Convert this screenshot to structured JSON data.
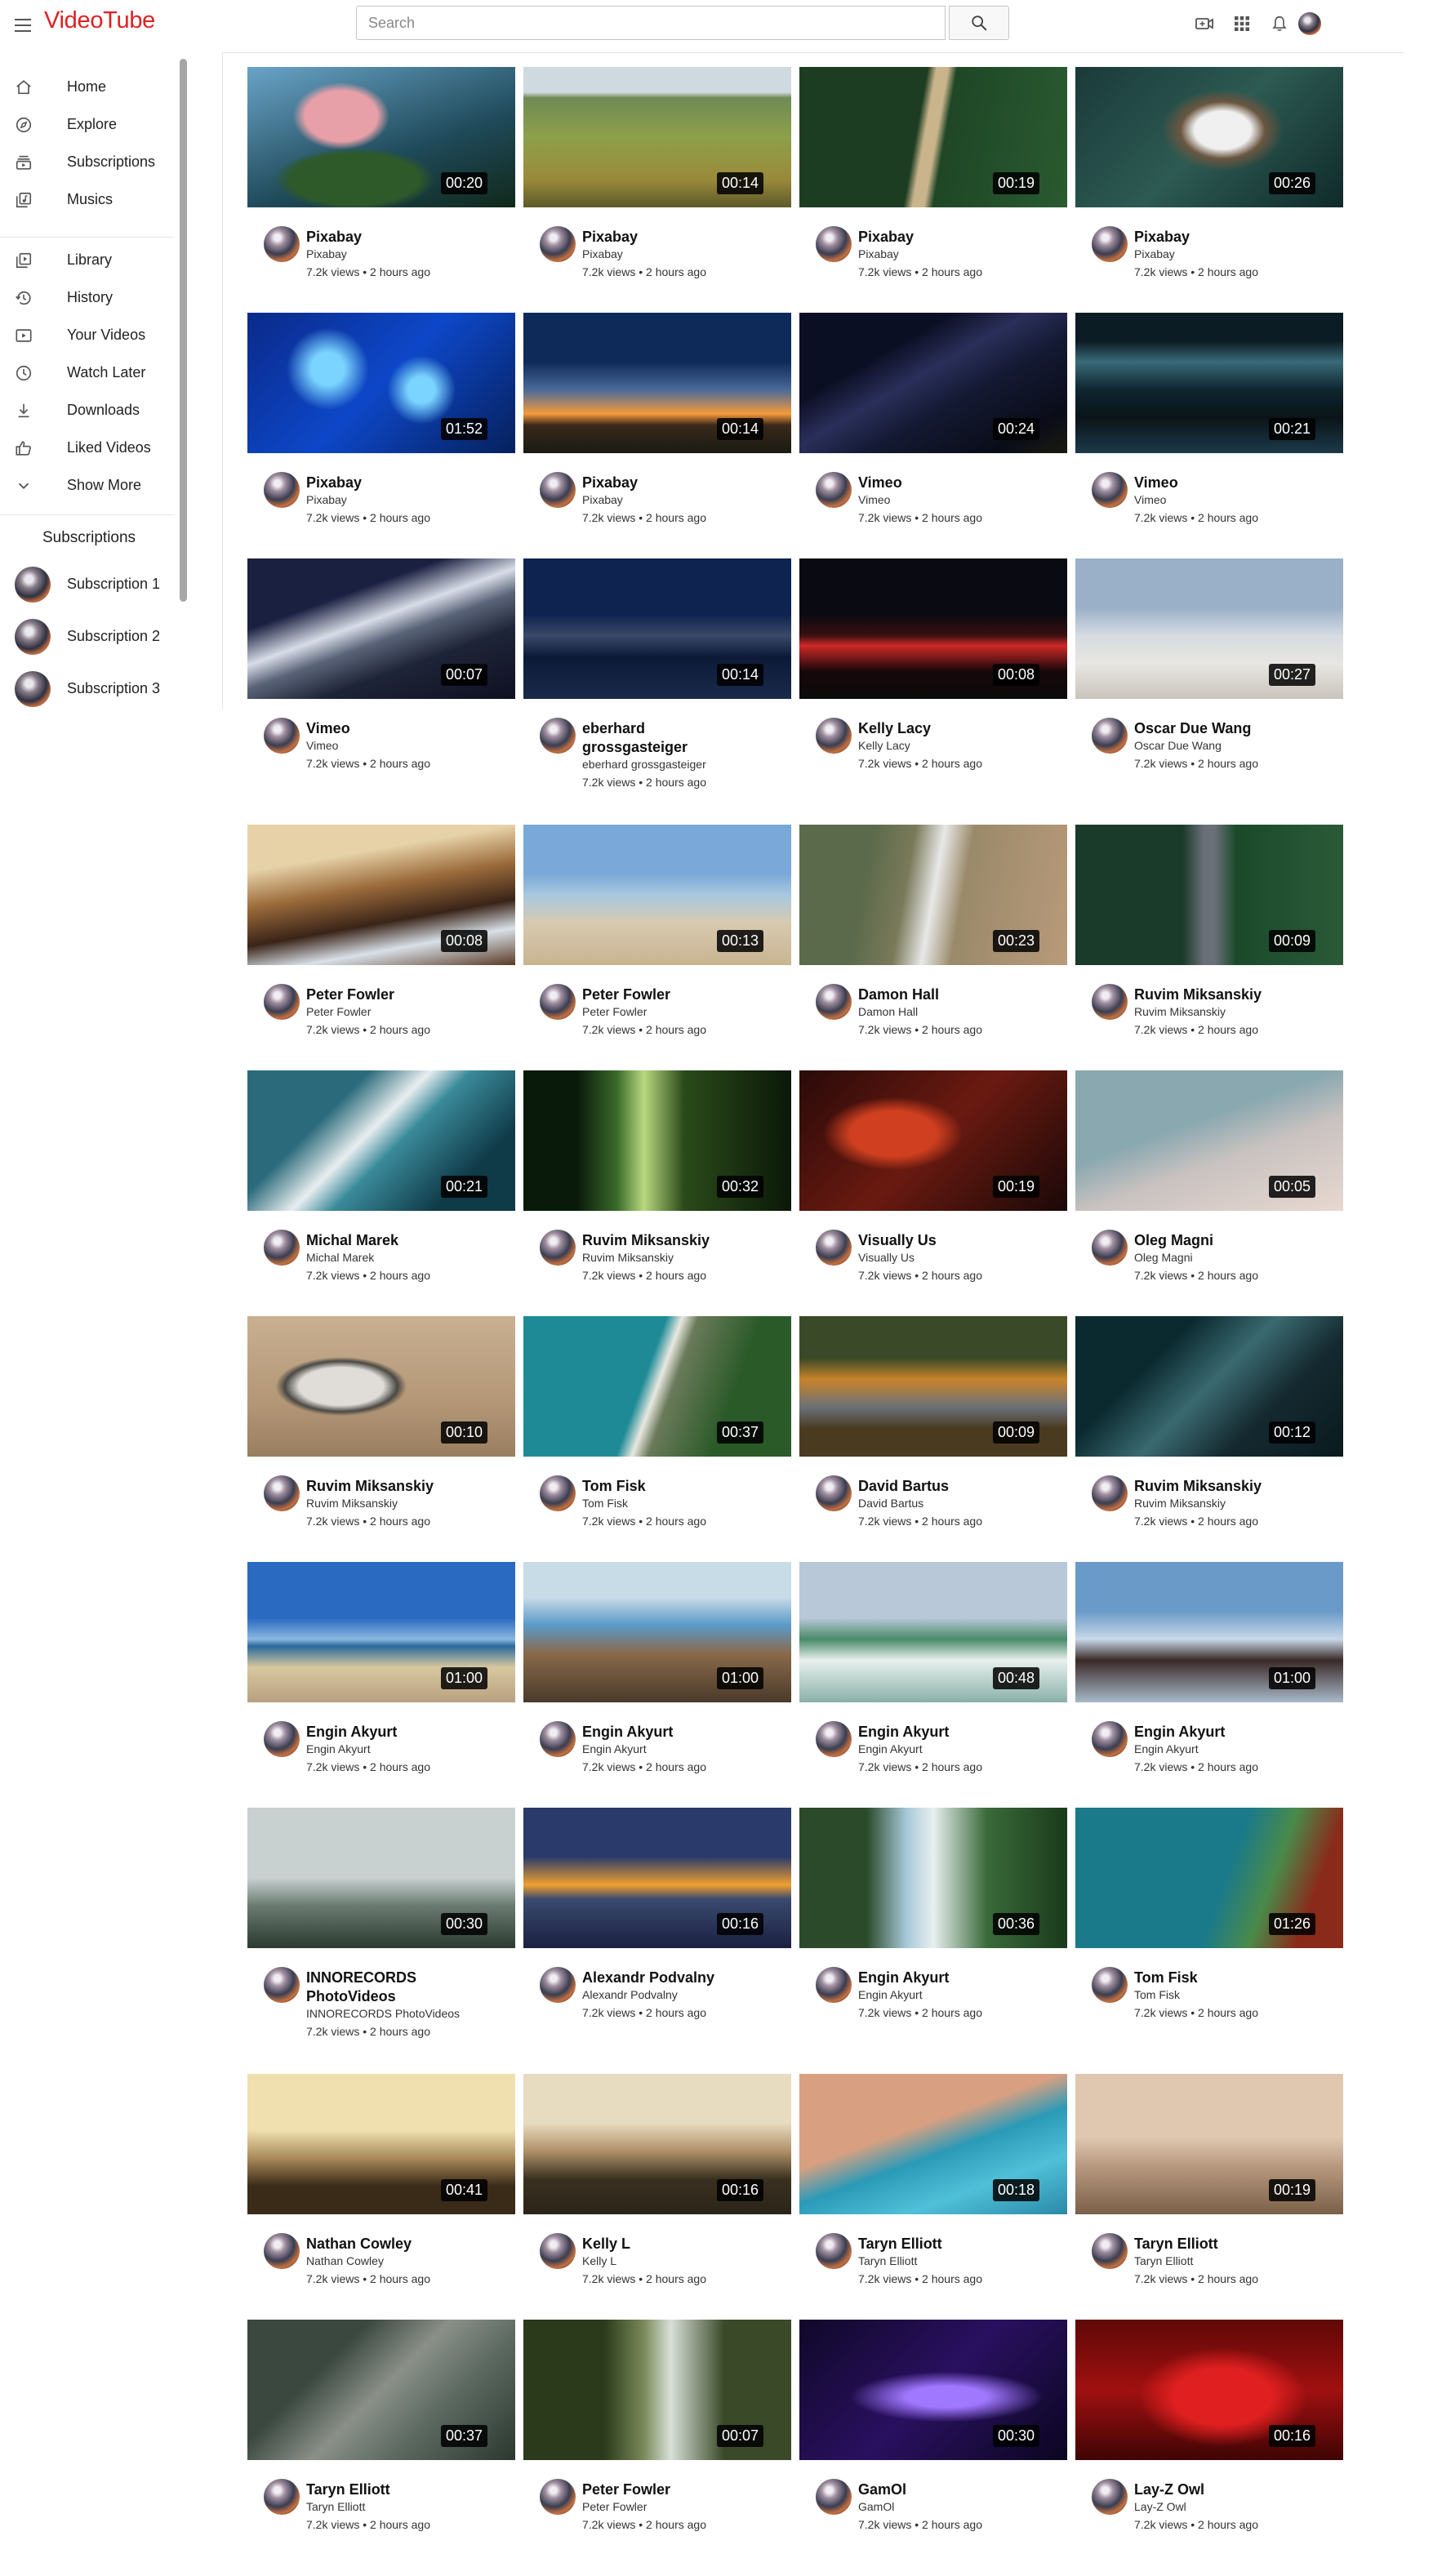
{
  "app": {
    "logo_text": "VideoTube",
    "brand_color": "#e02020"
  },
  "search": {
    "placeholder": "Search"
  },
  "header_icons": [
    "menu-icon",
    "search-icon",
    "create-video-icon",
    "apps-grid-icon",
    "notification-bell-icon",
    "user-avatar"
  ],
  "sidebar": {
    "items": [
      {
        "label": "Home",
        "icon": "home-icon"
      },
      {
        "label": "Explore",
        "icon": "explore-icon"
      },
      {
        "label": "Subscriptions",
        "icon": "subscriptions-icon"
      },
      {
        "label": "Musics",
        "icon": "music-icon"
      },
      {
        "label": "Library",
        "icon": "library-icon"
      },
      {
        "label": "History",
        "icon": "history-icon"
      },
      {
        "label": "Your Videos",
        "icon": "your-videos-icon"
      },
      {
        "label": "Watch Later",
        "icon": "clock-icon"
      },
      {
        "label": "Downloads",
        "icon": "download-icon"
      },
      {
        "label": "Liked Videos",
        "icon": "thumbs-up-icon"
      },
      {
        "label": "Show More",
        "icon": "chevron-down-icon"
      }
    ],
    "subscriptions_title": "Subscriptions",
    "subscriptions": [
      {
        "label": "Subscription 1"
      },
      {
        "label": "Subscription 2"
      },
      {
        "label": "Subscription 3"
      }
    ]
  },
  "videos": [
    {
      "title": "Pixabay",
      "channel": "Pixabay",
      "meta": "7.2k views • 2 hours ago",
      "duration": "00:20",
      "thumb": "pink flower on dark green"
    },
    {
      "title": "Pixabay",
      "channel": "Pixabay",
      "meta": "7.2k views • 2 hours ago",
      "duration": "00:14",
      "thumb": "cows grazing in meadow"
    },
    {
      "title": "Pixabay",
      "channel": "Pixabay",
      "meta": "7.2k views • 2 hours ago",
      "duration": "00:19",
      "thumb": "aerial forest road"
    },
    {
      "title": "Pixabay",
      "channel": "Pixabay",
      "meta": "7.2k views • 2 hours ago",
      "duration": "00:26",
      "thumb": "aerial waves on rocks"
    },
    {
      "title": "Pixabay",
      "channel": "Pixabay",
      "meta": "7.2k views • 2 hours ago",
      "duration": "01:52",
      "thumb": "blue jellyfish"
    },
    {
      "title": "Pixabay",
      "channel": "Pixabay",
      "meta": "7.2k views • 2 hours ago",
      "duration": "00:14",
      "thumb": "sunset over field with tree"
    },
    {
      "title": "Vimeo",
      "channel": "Vimeo",
      "meta": "7.2k views • 2 hours ago",
      "duration": "00:24",
      "thumb": "milky way night sky"
    },
    {
      "title": "Vimeo",
      "channel": "Vimeo",
      "meta": "7.2k views • 2 hours ago",
      "duration": "00:21",
      "thumb": "milky way over lake"
    },
    {
      "title": "Vimeo",
      "channel": "Vimeo",
      "meta": "7.2k views • 2 hours ago",
      "duration": "00:07",
      "thumb": "snowy mountains under stars"
    },
    {
      "title": "eberhard grossgasteiger",
      "channel": "eberhard grossgasteiger",
      "meta": "7.2k views • 2 hours ago",
      "duration": "00:14",
      "thumb": "mountain lake at dusk"
    },
    {
      "title": "Kelly Lacy",
      "channel": "Kelly Lacy",
      "meta": "7.2k views • 2 hours ago",
      "duration": "00:08",
      "thumb": "city street at night"
    },
    {
      "title": "Oscar Due Wang",
      "channel": "Oscar Due Wang",
      "meta": "7.2k views • 2 hours ago",
      "duration": "00:27",
      "thumb": "people walking on sandbar"
    },
    {
      "title": "Peter Fowler",
      "channel": "Peter Fowler",
      "meta": "7.2k views • 2 hours ago",
      "duration": "00:08",
      "thumb": "waves on rocks at sunset"
    },
    {
      "title": "Peter Fowler",
      "channel": "Peter Fowler",
      "meta": "7.2k views • 2 hours ago",
      "duration": "00:13",
      "thumb": "woman sitting on beach"
    },
    {
      "title": "Damon Hall",
      "channel": "Damon Hall",
      "meta": "7.2k views • 2 hours ago",
      "duration": "00:23",
      "thumb": "aerial beach waves"
    },
    {
      "title": "Ruvim Miksanskiy",
      "channel": "Ruvim Miksanskiy",
      "meta": "7.2k views • 2 hours ago",
      "duration": "00:09",
      "thumb": "aerial road through forest"
    },
    {
      "title": "Michal Marek",
      "channel": "Michal Marek",
      "meta": "7.2k views • 2 hours ago",
      "duration": "00:21",
      "thumb": "aerial turquoise waves"
    },
    {
      "title": "Ruvim Miksanskiy",
      "channel": "Ruvim Miksanskiy",
      "meta": "7.2k views • 2 hours ago",
      "duration": "00:32",
      "thumb": "sunlit forest"
    },
    {
      "title": "Visually Us",
      "channel": "Visually Us",
      "meta": "7.2k views • 2 hours ago",
      "duration": "00:19",
      "thumb": "red autumn leaves"
    },
    {
      "title": "Oleg Magni",
      "channel": "Oleg Magni",
      "meta": "7.2k views • 2 hours ago",
      "duration": "00:05",
      "thumb": "leaf silhouettes"
    },
    {
      "title": "Ruvim Miksanskiy",
      "channel": "Ruvim Miksanskiy",
      "meta": "7.2k views • 2 hours ago",
      "duration": "00:10",
      "thumb": "seal on sand"
    },
    {
      "title": "Tom Fisk",
      "channel": "Tom Fisk",
      "meta": "7.2k views • 2 hours ago",
      "duration": "00:37",
      "thumb": "aerial coastline"
    },
    {
      "title": "David Bartus",
      "channel": "David Bartus",
      "meta": "7.2k views • 2 hours ago",
      "duration": "00:09",
      "thumb": "autumn forest road"
    },
    {
      "title": "Ruvim Miksanskiy",
      "channel": "Ruvim Miksanskiy",
      "meta": "7.2k views • 2 hours ago",
      "duration": "00:12",
      "thumb": "underwater rocks"
    },
    {
      "title": "Engin Akyurt",
      "channel": "Engin Akyurt",
      "meta": "7.2k views • 2 hours ago",
      "duration": "01:00",
      "thumb": "beach with blue sky"
    },
    {
      "title": "Engin Akyurt",
      "channel": "Engin Akyurt",
      "meta": "7.2k views • 2 hours ago",
      "duration": "01:00",
      "thumb": "rocky shore"
    },
    {
      "title": "Engin Akyurt",
      "channel": "Engin Akyurt",
      "meta": "7.2k views • 2 hours ago",
      "duration": "00:48",
      "thumb": "crashing wave"
    },
    {
      "title": "Engin Akyurt",
      "channel": "Engin Akyurt",
      "meta": "7.2k views • 2 hours ago",
      "duration": "01:00",
      "thumb": "woman by the sea"
    },
    {
      "title": "INNORECORDS PhotoVideos",
      "channel": "INNORECORDS PhotoVideos",
      "meta": "7.2k views • 2 hours ago",
      "duration": "00:30",
      "thumb": "swing in fog"
    },
    {
      "title": "Alexandr Podvalny",
      "channel": "Alexandr Podvalny",
      "meta": "7.2k views • 2 hours ago",
      "duration": "00:16",
      "thumb": "sunset clouds over sea"
    },
    {
      "title": "Engin Akyurt",
      "channel": "Engin Akyurt",
      "meta": "7.2k views • 2 hours ago",
      "duration": "00:36",
      "thumb": "waterfalls"
    },
    {
      "title": "Tom Fisk",
      "channel": "Tom Fisk",
      "meta": "7.2k views • 2 hours ago",
      "duration": "01:26",
      "thumb": "aerial boat on turquoise water"
    },
    {
      "title": "Nathan Cowley",
      "channel": "Nathan Cowley",
      "meta": "7.2k views • 2 hours ago",
      "duration": "00:41",
      "thumb": "grass at golden sunset"
    },
    {
      "title": "Kelly L",
      "channel": "Kelly L",
      "meta": "7.2k views • 2 hours ago",
      "duration": "00:16",
      "thumb": "misty lake sunrise"
    },
    {
      "title": "Taryn Elliott",
      "channel": "Taryn Elliott",
      "meta": "7.2k views • 2 hours ago",
      "duration": "00:18",
      "thumb": "legs by swimming pool"
    },
    {
      "title": "Taryn Elliott",
      "channel": "Taryn Elliott",
      "meta": "7.2k views • 2 hours ago",
      "duration": "00:19",
      "thumb": "van with hot air balloons"
    },
    {
      "title": "Taryn Elliott",
      "channel": "Taryn Elliott",
      "meta": "7.2k views • 2 hours ago",
      "duration": "00:37",
      "thumb": "aerial city intersection"
    },
    {
      "title": "Peter Fowler",
      "channel": "Peter Fowler",
      "meta": "7.2k views • 2 hours ago",
      "duration": "00:07",
      "thumb": "man in forest"
    },
    {
      "title": "GamOl",
      "channel": "GamOl",
      "meta": "7.2k views • 2 hours ago",
      "duration": "00:30",
      "thumb": "purple abstract waves"
    },
    {
      "title": "Lay-Z Owl",
      "channel": "Lay-Z Owl",
      "meta": "7.2k views • 2 hours ago",
      "duration": "00:16",
      "thumb": "red lit back"
    }
  ]
}
